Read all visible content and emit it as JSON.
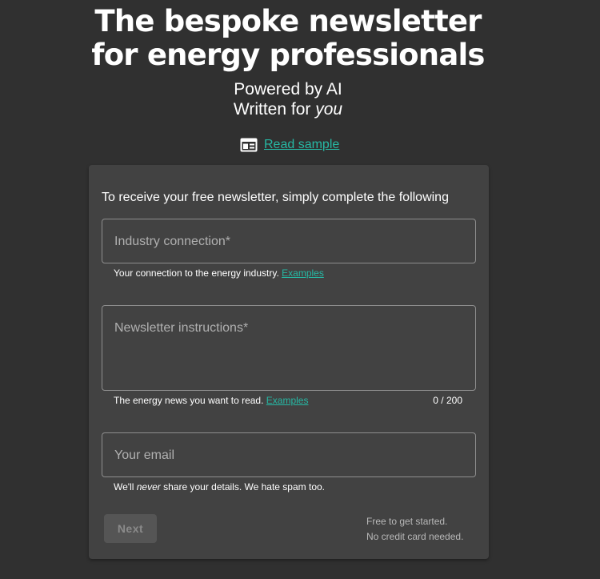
{
  "hero": {
    "title_line1": "The bespoke newsletter",
    "title_line2": "for energy professionals",
    "subtitle_line1": "Powered by AI",
    "subtitle_line2_prefix": "Written for ",
    "subtitle_line2_emphasis": "you"
  },
  "sample": {
    "icon": "newspaper-icon",
    "link_label": "Read sample"
  },
  "form": {
    "intro": "To receive your free newsletter, simply complete the following",
    "industry": {
      "label": "Industry connection*",
      "value": "",
      "helper": "Your connection to the energy industry.",
      "helper_link": "Examples"
    },
    "instructions": {
      "label": "Newsletter instructions*",
      "value": "",
      "helper": "The energy news you want to read.",
      "helper_link": "Examples",
      "counter": "0 / 200"
    },
    "email": {
      "label": "Your email",
      "value": "",
      "helper_prefix": "We'll ",
      "helper_emphasis": "never",
      "helper_suffix": " share your details. We hate spam too."
    },
    "next_label": "Next",
    "note_line1": "Free to get started.",
    "note_line2": "No credit card needed."
  },
  "colors": {
    "background": "#303030",
    "card": "#424242",
    "accent": "#26b8a4"
  }
}
